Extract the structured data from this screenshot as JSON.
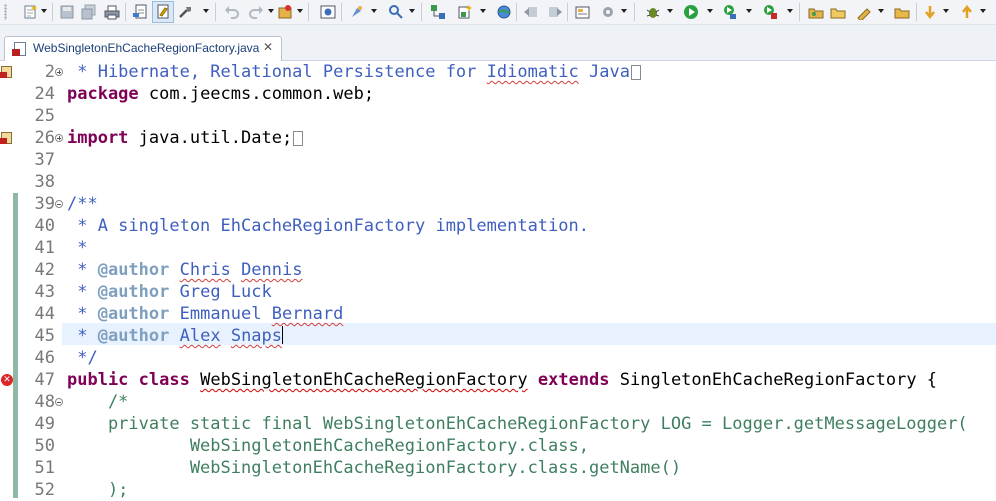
{
  "toolbar": {
    "icons": [
      "new-icon",
      "save-icon",
      "save-all-icon",
      "print-icon",
      "toggle-breadcrumb-icon",
      "toggle-mark-occurrences-icon",
      "build-icon",
      "undo-icon",
      "redo-icon",
      "new-java-project-icon",
      "open-type-icon",
      "search-icon",
      "open-task-icon",
      "new-class-icon",
      "globe-icon",
      "back-icon",
      "forward-icon",
      "open-perspective-icon",
      "settings-icon",
      "debug-icon",
      "run-icon",
      "coverage-icon",
      "external-tools-icon",
      "open-folder-icon",
      "open-project-icon",
      "pen-icon",
      "folder-icon",
      "next-annotation-icon",
      "previous-annotation-icon"
    ]
  },
  "editor_tab": {
    "title": "WebSingletonEhCacheRegionFactory.java",
    "close_glyph": "✕",
    "icon": "java-file-error-icon"
  },
  "code_lines": [
    {
      "number": "2",
      "text": " * Hibernate, Relational Persistence for Idiomatic Java"
    },
    {
      "number": "24",
      "text": "package com.jeecms.common.web;"
    },
    {
      "number": "25",
      "text": ""
    },
    {
      "number": "26",
      "text": "import java.util.Date;"
    },
    {
      "number": "37",
      "text": ""
    },
    {
      "number": "38",
      "text": ""
    },
    {
      "number": "39",
      "text": "/**"
    },
    {
      "number": "40",
      "text": " * A singleton EhCacheRegionFactory implementation."
    },
    {
      "number": "41",
      "text": " *"
    },
    {
      "number": "42",
      "text": " * @author Chris Dennis"
    },
    {
      "number": "43",
      "text": " * @author Greg Luck"
    },
    {
      "number": "44",
      "text": " * @author Emmanuel Bernard"
    },
    {
      "number": "45",
      "text": " * @author Alex Snaps"
    },
    {
      "number": "46",
      "text": " */"
    },
    {
      "number": "47",
      "text": "public class WebSingletonEhCacheRegionFactory extends SingletonEhCacheRegionFactory {"
    },
    {
      "number": "48",
      "text": "    /*"
    },
    {
      "number": "49",
      "text": "    private static final WebSingletonEhCacheRegionFactory LOG = Logger.getMessageLogger("
    },
    {
      "number": "50",
      "text": "            WebSingletonEhCacheRegionFactory.class,"
    },
    {
      "number": "51",
      "text": "            WebSingletonEhCacheRegionFactory.class.getName()"
    },
    {
      "number": "52",
      "text": "    );"
    }
  ],
  "colors": {
    "keyword": "#7f0055",
    "javadoc": "#3f5fbf",
    "javadoc_tag": "#7f9fbf",
    "comment": "#3f7f5f",
    "line_number": "#787878",
    "current_line": "#e8f2fe",
    "change_bar": "#8fb8a5"
  }
}
